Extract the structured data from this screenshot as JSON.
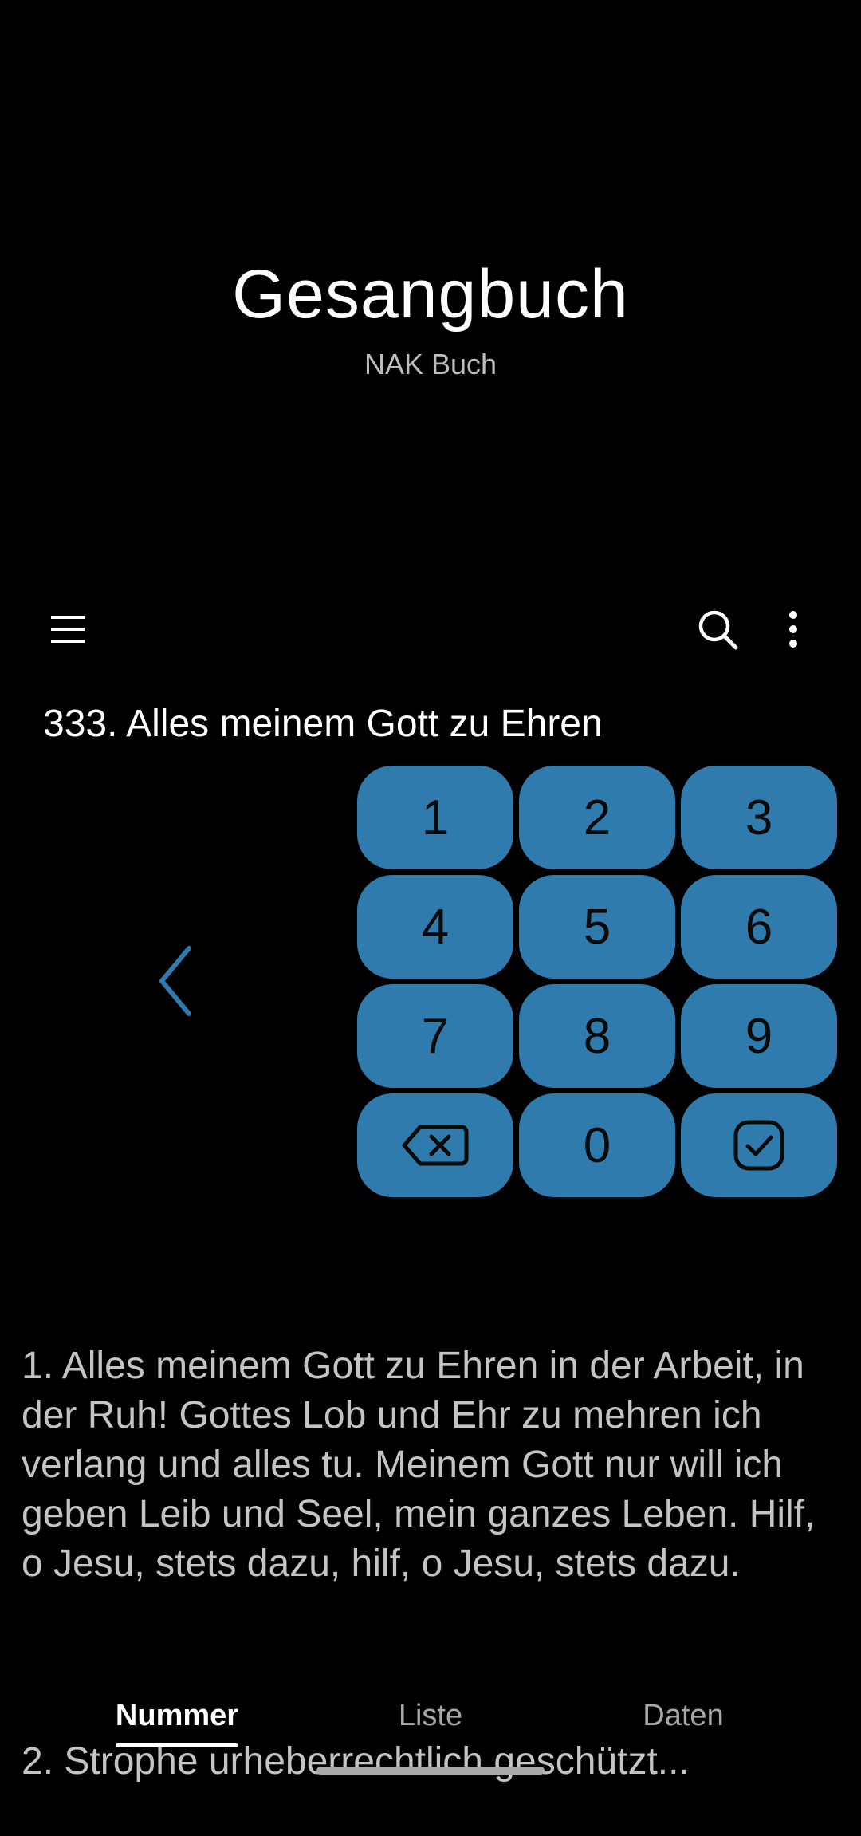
{
  "header": {
    "title": "Gesangbuch",
    "subtitle": "NAK Buch"
  },
  "toolbar": {
    "menu_icon": "hamburger-menu-icon",
    "search_icon": "search-icon",
    "more_icon": "more-vert-icon"
  },
  "song": {
    "title": "333. Alles meinem Gott zu Ehren"
  },
  "keypad": {
    "keys": [
      "1",
      "2",
      "3",
      "4",
      "5",
      "6",
      "7",
      "8",
      "9",
      "",
      "0",
      ""
    ],
    "backspace_icon": "backspace-icon",
    "confirm_icon": "check-square-icon",
    "color": "#2f7bad"
  },
  "back_icon": "chevron-left-icon",
  "lyrics": {
    "verse1": "1. Alles meinem Gott zu Ehren in der Arbeit, in der Ruh! Gottes Lob und Ehr zu mehren ich verlang und alles tu. Meinem Gott nur will ich geben Leib und Seel, mein ganzes Leben. Hilf, o Jesu, stets dazu, hilf, o Jesu, stets dazu.",
    "verse2": "2. Strophe urheberrechtlich geschützt..."
  },
  "bottom_nav": {
    "tabs": [
      {
        "label": "Nummer",
        "active": true
      },
      {
        "label": "Liste",
        "active": false
      },
      {
        "label": "Daten",
        "active": false
      }
    ]
  }
}
